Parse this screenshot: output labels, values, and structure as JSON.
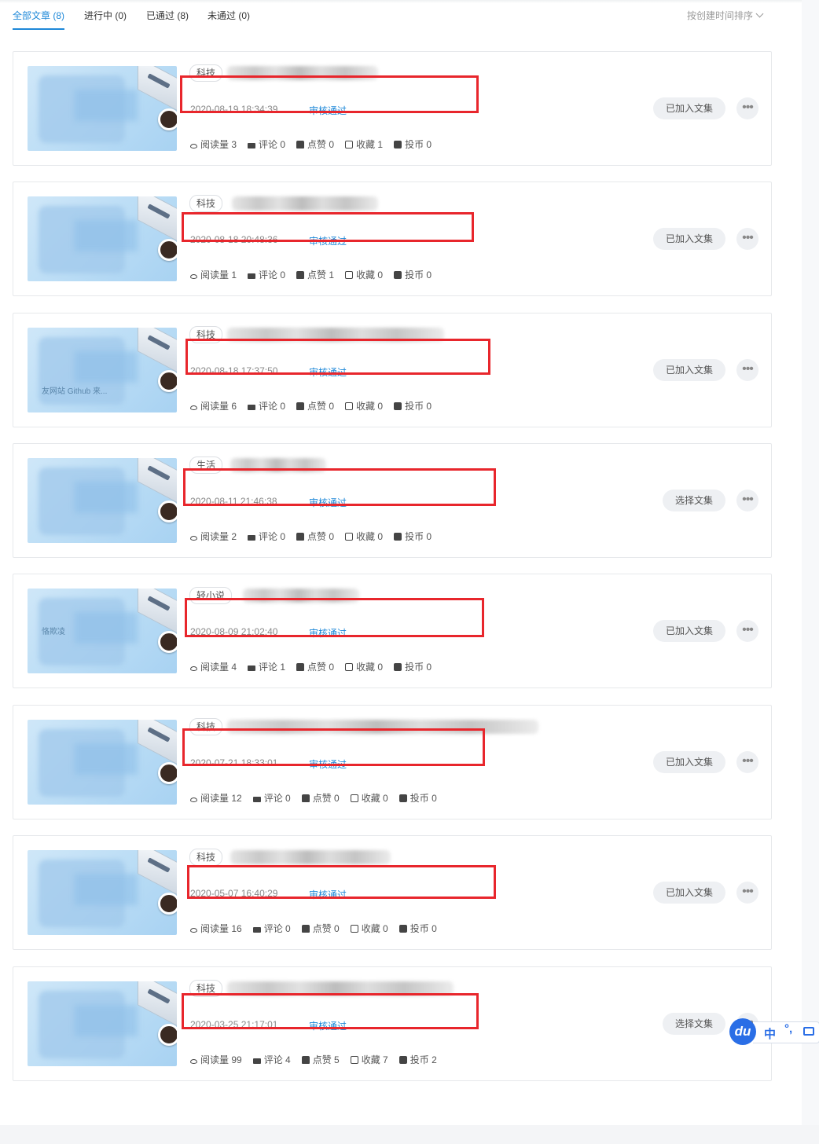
{
  "tabs": [
    {
      "label": "全部文章 (8)",
      "active": true
    },
    {
      "label": "进行中 (0)",
      "active": false
    },
    {
      "label": "已通过 (8)",
      "active": false
    },
    {
      "label": "未通过 (0)",
      "active": false
    }
  ],
  "sort_label": "按创建时间排序",
  "stat_labels": {
    "views": "阅读量",
    "comments": "评论",
    "likes": "点赞",
    "favorites": "收藏",
    "coins": "投币"
  },
  "more_glyph": "•••",
  "articles": [
    {
      "category": "科技",
      "date": "2020-08-19 18:34:39",
      "status": "审核通过",
      "stats": {
        "views": "阅读量 3",
        "comments": "评论 0",
        "likes": "点赞 0",
        "favorites": "收藏 1",
        "coins": "投币 0"
      },
      "collection_button": "已加入文集"
    },
    {
      "category": "科技",
      "date": "2020-08-18 20:48:36",
      "status": "审核通过",
      "stats": {
        "views": "阅读量 1",
        "comments": "评论 0",
        "likes": "点赞 1",
        "favorites": "收藏 0",
        "coins": "投币 0"
      },
      "collection_button": "已加入文集"
    },
    {
      "category": "科技",
      "date": "2020-08-18 17:37:50",
      "status": "审核通过",
      "thumb_text": "友网站 Github 来...",
      "stats": {
        "views": "阅读量 6",
        "comments": "评论 0",
        "likes": "点赞 0",
        "favorites": "收藏 0",
        "coins": "投币 0"
      },
      "collection_button": "已加入文集"
    },
    {
      "category": "生活",
      "date": "2020-08-11 21:46:38",
      "status": "审核通过",
      "stats": {
        "views": "阅读量 2",
        "comments": "评论 0",
        "likes": "点赞 0",
        "favorites": "收藏 0",
        "coins": "投币 0"
      },
      "collection_button": "选择文集"
    },
    {
      "category": "轻小说",
      "date": "2020-08-09 21:02:40",
      "status": "审核通过",
      "thumb_text": "恪欺凌",
      "stats": {
        "views": "阅读量 4",
        "comments": "评论 1",
        "likes": "点赞 0",
        "favorites": "收藏 0",
        "coins": "投币 0"
      },
      "collection_button": "已加入文集"
    },
    {
      "category": "科技",
      "date": "2020-07-21 18:33:01",
      "status": "审核通过",
      "stats": {
        "views": "阅读量 12",
        "comments": "评论 0",
        "likes": "点赞 0",
        "favorites": "收藏 0",
        "coins": "投币 0"
      },
      "collection_button": "已加入文集"
    },
    {
      "category": "科技",
      "date": "2020-05-07 16:40:29",
      "status": "审核通过",
      "stats": {
        "views": "阅读量 16",
        "comments": "评论 0",
        "likes": "点赞 0",
        "favorites": "收藏 0",
        "coins": "投币 0"
      },
      "collection_button": "已加入文集"
    },
    {
      "category": "科技",
      "date": "2020-03-25 21:17:01",
      "status": "审核通过",
      "stats": {
        "views": "阅读量 99",
        "comments": "评论 4",
        "likes": "点赞 5",
        "favorites": "收藏 7",
        "coins": "投币 2"
      },
      "collection_button": "选择文集"
    }
  ],
  "ime": {
    "logo": "du",
    "mode": "中",
    "punctuation": "°,"
  },
  "colors": {
    "accent": "#1e88d8",
    "highlight_box": "#e8262c"
  }
}
